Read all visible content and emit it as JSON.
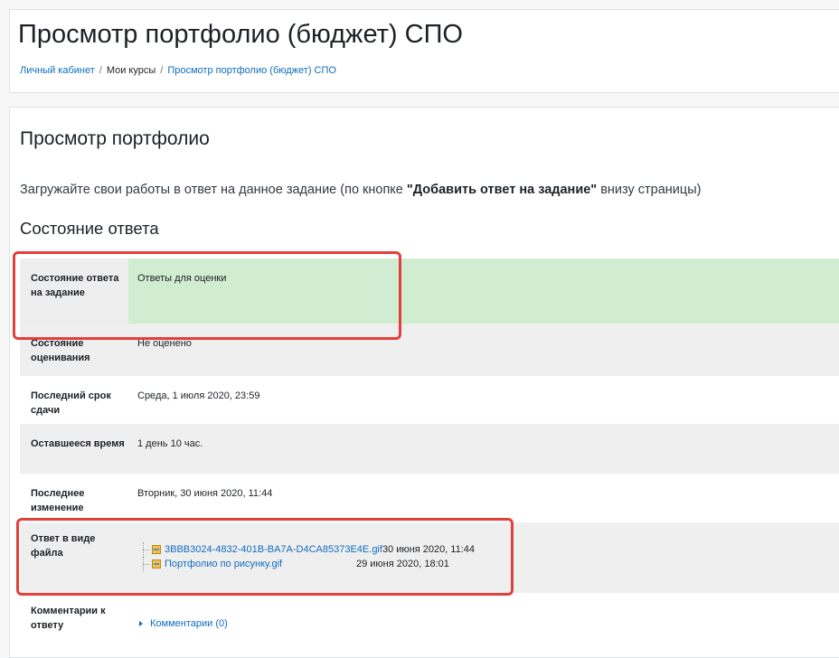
{
  "header": {
    "title": "Просмотр портфолио (бюджет) СПО",
    "breadcrumb": [
      {
        "label": "Личный кабинет",
        "link": true
      },
      {
        "label": "Мои курсы",
        "link": false
      },
      {
        "label": "Просмотр портфолио (бюджет) СПО",
        "link": true
      }
    ]
  },
  "main": {
    "heading": "Просмотр портфолио",
    "intro_before": "Загружайте свои работы в ответ на данное задание (по кнопке ",
    "intro_bold": "\"Добавить ответ на задание\"",
    "intro_after": " внизу страницы)",
    "status_heading": "Состояние ответа"
  },
  "status_table": {
    "rows": [
      {
        "label": "Состояние ответа на задание",
        "value": "Ответы для оценки"
      },
      {
        "label": "Состояние оценивания",
        "value": "Не оценено"
      },
      {
        "label": "Последний срок сдачи",
        "value": "Среда, 1 июля 2020, 23:59"
      },
      {
        "label": "Оставшееся время",
        "value": "1 день 10 час."
      },
      {
        "label": "Последнее изменение",
        "value": "Вторник, 30 июня 2020, 11:44"
      },
      {
        "label": "Ответ в виде файла",
        "files": [
          {
            "name": "3BBB3024-4832-401B-BA7A-D4CA85373E4E.gif",
            "date": "30 июня 2020, 11:44"
          },
          {
            "name": "Портфолио по рисунку.gif",
            "date": "29 июня 2020, 18:01"
          }
        ]
      },
      {
        "label": "Комментарии к ответу",
        "comments": "Комментарии (0)"
      }
    ]
  },
  "colors": {
    "submitted_bg": "#d0ecd1",
    "highlight_border": "#e2403a",
    "link": "#0f6cbf"
  }
}
